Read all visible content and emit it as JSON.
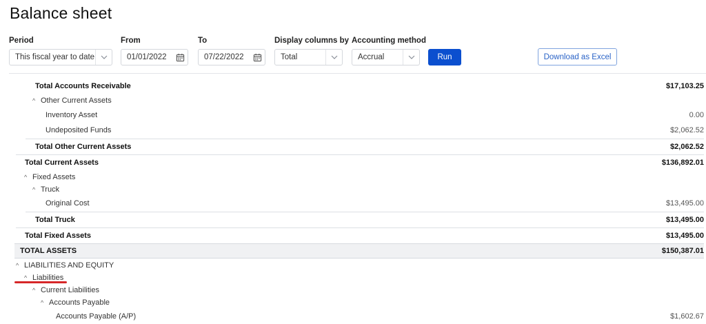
{
  "page": {
    "title": "Balance sheet"
  },
  "filters": {
    "period": {
      "label": "Period",
      "value": "This fiscal year to date"
    },
    "from": {
      "label": "From",
      "value": "01/01/2022"
    },
    "to": {
      "label": "To",
      "value": "07/22/2022"
    },
    "display_columns": {
      "label": "Display columns by",
      "value": "Total"
    },
    "accounting_method": {
      "label": "Accounting method",
      "value": "Accrual"
    }
  },
  "buttons": {
    "run": "Run",
    "download": "Download as Excel"
  },
  "report": {
    "rows": [
      {
        "label": "Total Accounts Receivable",
        "amount": "$17,103.25"
      },
      {
        "label": "Other Current Assets",
        "amount": ""
      },
      {
        "label": "Inventory Asset",
        "amount": "0.00"
      },
      {
        "label": "Undeposited Funds",
        "amount": "$2,062.52"
      },
      {
        "label": "Total Other Current Assets",
        "amount": "$2,062.52"
      },
      {
        "label": "Total Current Assets",
        "amount": "$136,892.01"
      },
      {
        "label": "Fixed Assets",
        "amount": ""
      },
      {
        "label": "Truck",
        "amount": ""
      },
      {
        "label": "Original Cost",
        "amount": "$13,495.00"
      },
      {
        "label": "Total Truck",
        "amount": "$13,495.00"
      },
      {
        "label": "Total Fixed Assets",
        "amount": "$13,495.00"
      },
      {
        "label": "TOTAL ASSETS",
        "amount": "$150,387.01"
      },
      {
        "label": "LIABILITIES AND EQUITY",
        "amount": ""
      },
      {
        "label": "Liabilities",
        "amount": ""
      },
      {
        "label": "Current Liabilities",
        "amount": ""
      },
      {
        "label": "Accounts Payable",
        "amount": ""
      },
      {
        "label": "Accounts Payable (A/P)",
        "amount": "$1,602.67"
      }
    ]
  },
  "colors": {
    "accent": "#0b4fcf",
    "highlight_underline": "#d62728"
  },
  "icons": {
    "dropdown": "chevron-down-icon",
    "calendar": "calendar-icon",
    "collapse": "caret-up-icon"
  }
}
